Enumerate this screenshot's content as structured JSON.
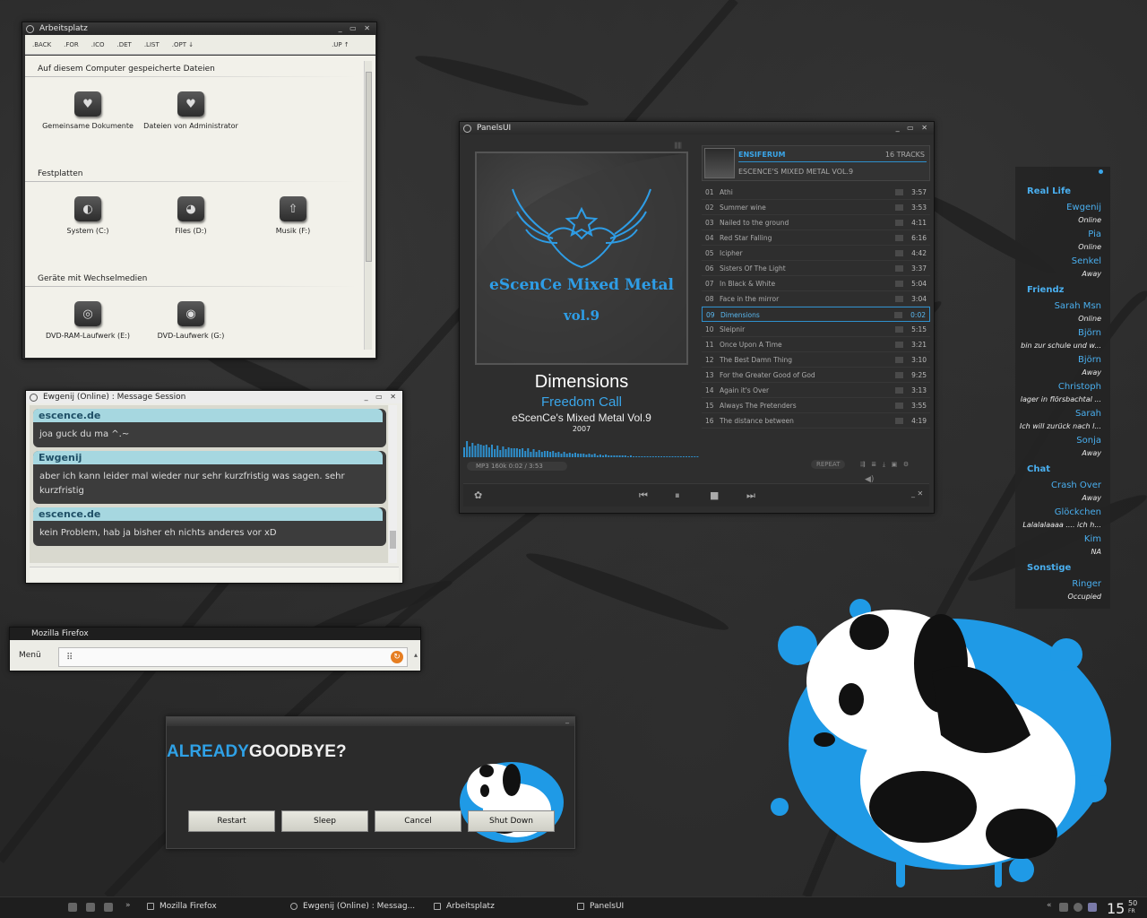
{
  "explorer": {
    "title": "Arbeitsplatz",
    "toolbar": [
      ".BACK",
      ".FOR",
      ".ICO",
      ".DET",
      ".LIST",
      ".OPT ↓",
      ".UP ↑"
    ],
    "sections": {
      "files": "Auf diesem Computer gespeicherte Dateien",
      "disks": "Festplatten",
      "removable": "Geräte mit Wechselmedien"
    },
    "items": {
      "shared_docs": "Gemeinsame Dokumente",
      "admin_files": "Dateien von Administrator",
      "system": "System (C:)",
      "files": "Files (D:)",
      "music": "Musik (F:)",
      "dvdram": "DVD-RAM-Laufwerk (E:)",
      "dvd": "DVD-Laufwerk (G:)"
    }
  },
  "chat": {
    "title": "Ewgenij (Online) : Message Session",
    "messages": [
      {
        "sender": "escence.de",
        "text": "joa guck du ma ^.~"
      },
      {
        "sender": "Ewgenij",
        "text": "aber ich kann leider mal wieder nur sehr kurzfristig was sagen. sehr kurzfristig"
      },
      {
        "sender": "escence.de",
        "text": "kein Problem, hab ja bisher eh nichts anderes vor xD"
      }
    ]
  },
  "firefox": {
    "title": "Mozilla Firefox",
    "menu_label": "Menü"
  },
  "logout": {
    "title_a": "ALREADY",
    "title_b": "GOODBYE?",
    "buttons": [
      "Restart",
      "Sleep",
      "Cancel",
      "Shut Down"
    ]
  },
  "player": {
    "title": "PanelsUI",
    "now_title": "Dimensions",
    "now_artist": "Freedom Call",
    "now_album": "eScenCe's Mixed Metal Vol.9",
    "now_year": "2007",
    "cover_text": "eScenCe Mixed Metal",
    "cover_vol": "vol.9",
    "status": "MP3 160k   0:02 / 3:53",
    "repeat": "REPEAT",
    "header_artist": "ENSIFERUM",
    "header_album": "ESCENCE'S MIXED METAL VOL.9",
    "header_count": "16 TRACKS",
    "active_track": 9,
    "tracks": [
      {
        "n": "01",
        "title": "Athi",
        "dur": "3:57"
      },
      {
        "n": "02",
        "title": "Summer wine",
        "dur": "3:53"
      },
      {
        "n": "03",
        "title": "Nailed to the ground",
        "dur": "4:11"
      },
      {
        "n": "04",
        "title": "Red Star Falling",
        "dur": "6:16"
      },
      {
        "n": "05",
        "title": "Icipher",
        "dur": "4:42"
      },
      {
        "n": "06",
        "title": "Sisters Of The Light",
        "dur": "3:37"
      },
      {
        "n": "07",
        "title": "In Black & White",
        "dur": "5:04"
      },
      {
        "n": "08",
        "title": "Face in the mirror",
        "dur": "3:04"
      },
      {
        "n": "09",
        "title": "Dimensions",
        "dur": "0:02"
      },
      {
        "n": "10",
        "title": "Sleipnir",
        "dur": "5:15"
      },
      {
        "n": "11",
        "title": "Once Upon A Time",
        "dur": "3:21"
      },
      {
        "n": "12",
        "title": "The Best Damn Thing",
        "dur": "3:10"
      },
      {
        "n": "13",
        "title": "For the Greater Good of God",
        "dur": "9:25"
      },
      {
        "n": "14",
        "title": "Again it's Over",
        "dur": "3:13"
      },
      {
        "n": "15",
        "title": "Always The Pretenders",
        "dur": "3:55"
      },
      {
        "n": "16",
        "title": "The distance between",
        "dur": "4:19"
      }
    ]
  },
  "buddies": {
    "groups": [
      {
        "name": "Real Life",
        "contacts": [
          {
            "name": "Ewgenij",
            "status": "Online"
          },
          {
            "name": "Pia",
            "status": "Online"
          },
          {
            "name": "Senkel",
            "status": "Away"
          }
        ]
      },
      {
        "name": "Friendz",
        "contacts": [
          {
            "name": "Sarah Msn",
            "status": "Online"
          },
          {
            "name": "Björn",
            "status": "bin zur schule und w..."
          },
          {
            "name": "Björn",
            "status": "Away"
          },
          {
            "name": "Christoph",
            "status": "lager in flörsbachtal ..."
          },
          {
            "name": "Sarah",
            "status": "Ich will zurück nach l..."
          },
          {
            "name": "Sonja",
            "status": "Away"
          }
        ]
      },
      {
        "name": "Chat",
        "contacts": [
          {
            "name": "Crash Over",
            "status": "Away"
          },
          {
            "name": "Glöckchen",
            "status": "Lalalalaaaa .... ich h..."
          },
          {
            "name": "Kim",
            "status": "NA"
          }
        ]
      },
      {
        "name": "Sonstige",
        "contacts": [
          {
            "name": "Ringer",
            "status": "Occupied"
          }
        ]
      }
    ]
  },
  "taskbar": {
    "tasks": [
      "Mozilla Firefox",
      "Ewgenij (Online) : Messag...",
      "Arbeitsplatz",
      "PanelsUI"
    ],
    "clock_hour": "15",
    "clock_min": "50",
    "clock_day": "FR"
  },
  "colors": {
    "accent": "#3aa6ea",
    "desktop": "#262626",
    "panda_splash": "#1f9ae6"
  }
}
